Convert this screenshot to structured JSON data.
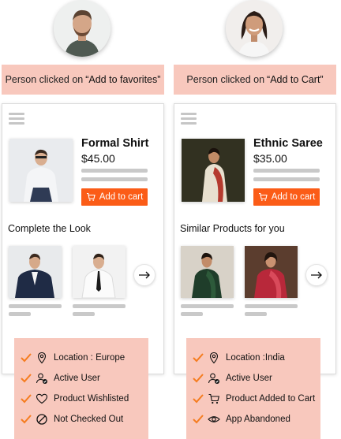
{
  "colors": {
    "accent": "#fb5c17",
    "banner_bg": "#f8c8bd",
    "check": "#f57c1f",
    "placeholder_line": "#c9c9c9"
  },
  "scenarios": [
    {
      "avatar": "male-person-avatar",
      "banner_prefix": "Person clicked on",
      "banner_action": "“Add to favorites”",
      "product_name": "Formal Shirt",
      "product_price": "$45.00",
      "add_button_label": "Add to cart",
      "section_title": "Complete the Look",
      "attributes": [
        {
          "icon": "location-pin-icon",
          "label": "Location : Europe"
        },
        {
          "icon": "user-check-icon",
          "label": "Active User"
        },
        {
          "icon": "heart-icon",
          "label": "Product Wishlisted"
        },
        {
          "icon": "no-entry-icon",
          "label": "Not Checked Out"
        }
      ]
    },
    {
      "avatar": "female-person-avatar",
      "banner_prefix": "Person clicked on",
      "banner_action": "“Add to Cart”",
      "product_name": "Ethnic Saree",
      "product_price": "$35.00",
      "add_button_label": "Add to cart",
      "section_title": "Similar Products for you",
      "attributes": [
        {
          "icon": "location-pin-icon",
          "label": "Location :India"
        },
        {
          "icon": "user-check-icon",
          "label": "Active User"
        },
        {
          "icon": "cart-icon",
          "label": "Product Added to Cart"
        },
        {
          "icon": "eye-icon",
          "label": "App Abandoned"
        }
      ]
    }
  ]
}
